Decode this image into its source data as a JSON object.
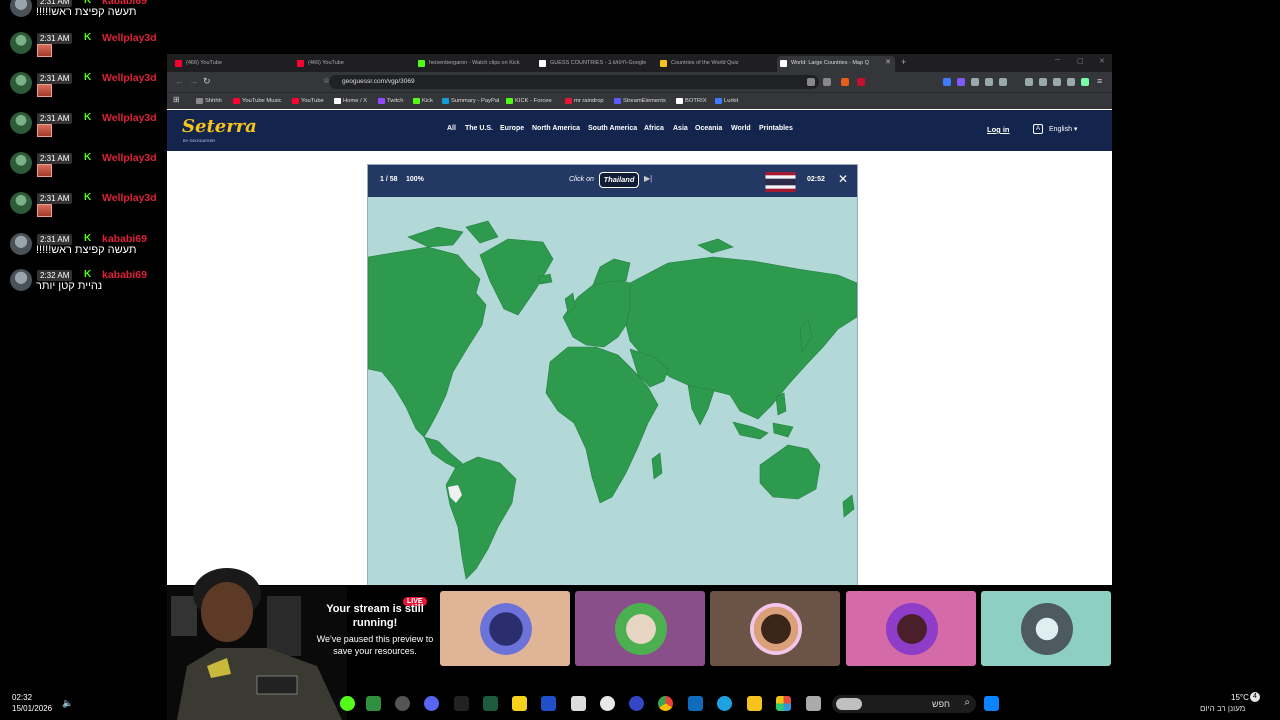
{
  "chat": {
    "messages": [
      {
        "time": "2:31 AM",
        "user": "kababi69",
        "text": "!!!!!תעשה קפיצת ראש",
        "avatar": "kababi",
        "emote": false
      },
      {
        "time": "2:31 AM",
        "user": "Wellplay3d",
        "text": "",
        "avatar": "well",
        "emote": true
      },
      {
        "time": "2:31 AM",
        "user": "Wellplay3d",
        "text": "",
        "avatar": "well",
        "emote": true
      },
      {
        "time": "2:31 AM",
        "user": "Wellplay3d",
        "text": "",
        "avatar": "well",
        "emote": true
      },
      {
        "time": "2:31 AM",
        "user": "Wellplay3d",
        "text": "",
        "avatar": "well",
        "emote": true
      },
      {
        "time": "2:31 AM",
        "user": "Wellplay3d",
        "text": "",
        "avatar": "well",
        "emote": true
      },
      {
        "time": "2:31 AM",
        "user": "kababi69",
        "text": "!!!!!תעשה קפיצת ראש",
        "avatar": "kababi",
        "emote": false
      },
      {
        "time": "2:32 AM",
        "user": "kababi69",
        "text": "נהיית קטן יותר",
        "avatar": "kababi",
        "emote": false
      }
    ]
  },
  "browser": {
    "tabs": [
      {
        "label": "(466) YouTube",
        "color": "#ff0033",
        "active": false
      },
      {
        "label": "(466) YouTube",
        "color": "#ff0033",
        "active": false
      },
      {
        "label": "heisenbergaron - Watch clips on Kick",
        "color": "#53fc18",
        "active": false
      },
      {
        "label": "GUESS COUNTRIES - חיפוש ב-Google",
        "color": "#ffffff",
        "active": false
      },
      {
        "label": "Countries of the World Quiz",
        "color": "#f6c41c",
        "active": false
      },
      {
        "label": "World: Large Countries - Map Q",
        "color": "#ffffff",
        "active": true
      }
    ],
    "new_tab": "+",
    "url": "geoguessr.com/vgp/3069",
    "bookmarks": [
      {
        "label": "Shhhh",
        "color": "#888888"
      },
      {
        "label": "YouTube Music",
        "color": "#ff0033"
      },
      {
        "label": "YouTube",
        "color": "#ff0033"
      },
      {
        "label": "Home / X",
        "color": "#ffffff"
      },
      {
        "label": "Twitch",
        "color": "#9146ff"
      },
      {
        "label": "Kick",
        "color": "#53fc18"
      },
      {
        "label": "Summary - PayPal",
        "color": "#169bd7"
      },
      {
        "label": "KICK - Forcee",
        "color": "#53fc18"
      },
      {
        "label": "mr raindrop",
        "color": "#e5163a"
      },
      {
        "label": "StreamElements",
        "color": "#5b5bff"
      },
      {
        "label": "BOTRIX",
        "color": "#ffffff"
      },
      {
        "label": "Lurkit",
        "color": "#3d7bff"
      }
    ]
  },
  "seterra": {
    "logo": "Seterra",
    "logo_sub": "BY GEOGUESSR",
    "nav": [
      "All",
      "The U.S.",
      "Europe",
      "North America",
      "South America",
      "Africa",
      "Asia",
      "Oceania",
      "World",
      "Printables"
    ],
    "login": "Log in",
    "language": "English",
    "game": {
      "counter": "1 / 58",
      "percent": "100%",
      "click_on": "Click on",
      "target": "Thailand",
      "timer": "02:52"
    }
  },
  "stream": {
    "live_badge": "LIVE",
    "paused_title": "Your stream is still running!",
    "paused_sub": "We've paused this preview to save your resources."
  },
  "taskbar": {
    "time": "02:32",
    "date": "15/01/2026",
    "search_placeholder": "חפש",
    "temperature": "15°C",
    "weather": "מעונן רב היום",
    "notifications": "4"
  },
  "colors": {
    "land": "#2e9a4e",
    "water": "#b2d8d8",
    "seterra_header": "#14254d",
    "game_bar": "#233863",
    "kick_green": "#53fc18",
    "username_red": "#e0203a"
  }
}
